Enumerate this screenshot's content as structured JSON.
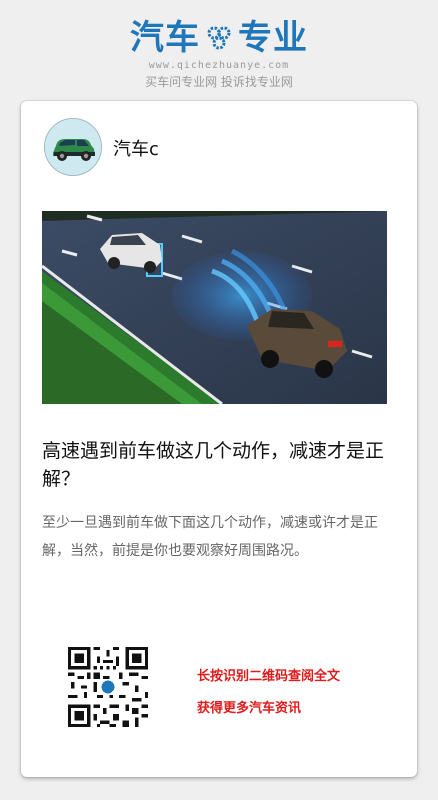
{
  "brand": {
    "word_left": "汽车",
    "word_right": "专业",
    "url": "www.qichezhuanye.com",
    "slogan": "买车问专业网 投诉找专业网"
  },
  "author": {
    "name": "汽车c"
  },
  "article": {
    "title": "高速遇到前车做这几个动作，减速才是正解？",
    "summary": "至少一旦遇到前车做下面这几个动作，减速或许才是正解，当然，前提是你也要观察好周围路况。"
  },
  "cta": {
    "line1": "长按识别二维码查阅全文",
    "line2": "获得更多汽车资讯"
  },
  "colors": {
    "brand": "#1f76b8",
    "cta": "#e01b1b"
  },
  "icons": {
    "logo": "gear-icon",
    "qr": "qr-code"
  }
}
